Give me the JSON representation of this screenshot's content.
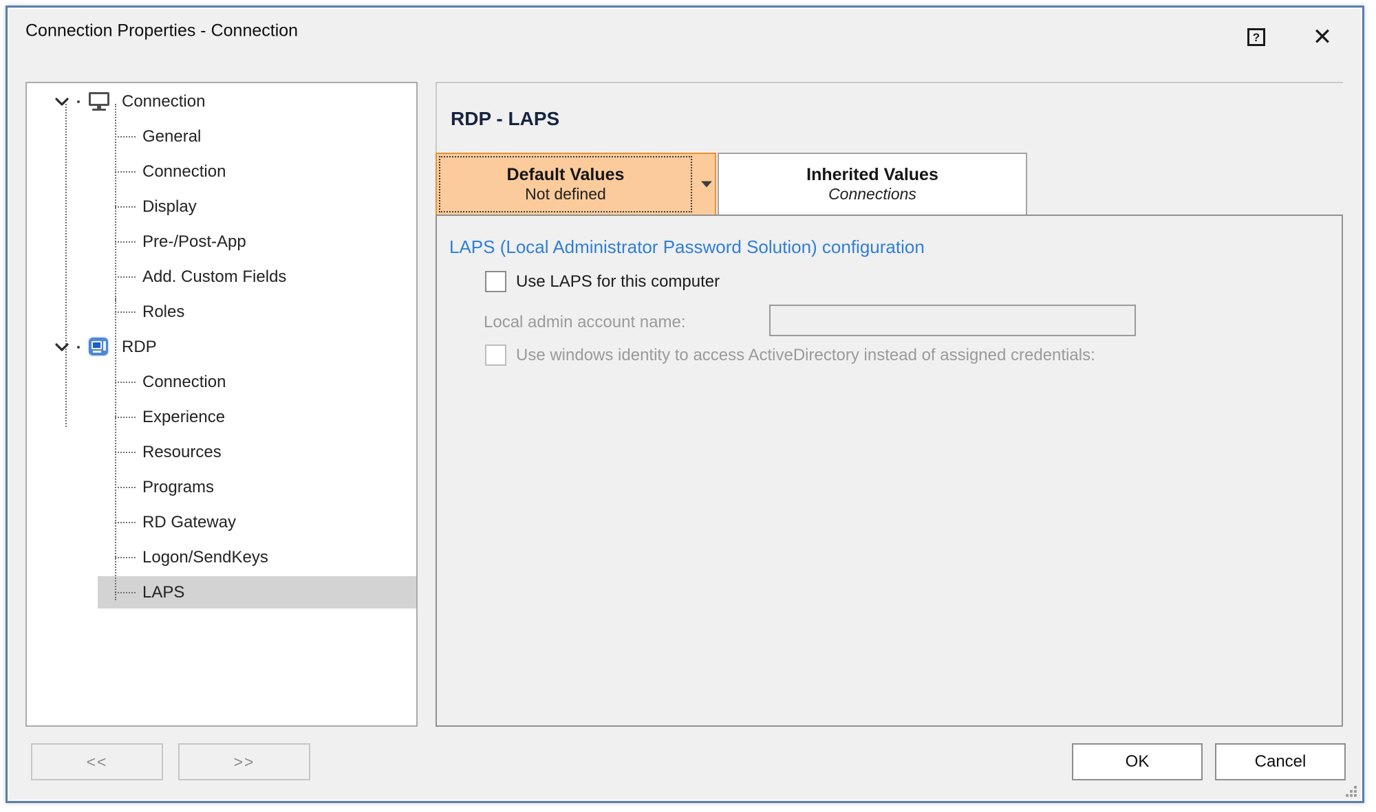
{
  "window": {
    "title": "Connection Properties - Connection",
    "help_icon": "help-icon",
    "help_glyph": "?",
    "close_icon": "close-icon",
    "close_glyph": "✕",
    "accent_border": "#5a7fad",
    "face_color": "#f0f0f0"
  },
  "tree": {
    "nodes": [
      {
        "label": "Connection",
        "level": 0,
        "icon": "monitor-icon",
        "expanded": true,
        "selected": false
      },
      {
        "label": "General",
        "level": 1,
        "icon": null,
        "expanded": null,
        "selected": false
      },
      {
        "label": "Connection",
        "level": 1,
        "icon": null,
        "expanded": null,
        "selected": false
      },
      {
        "label": "Display",
        "level": 1,
        "icon": null,
        "expanded": null,
        "selected": false
      },
      {
        "label": "Pre-/Post-App",
        "level": 1,
        "icon": null,
        "expanded": null,
        "selected": false
      },
      {
        "label": "Add. Custom Fields",
        "level": 1,
        "icon": null,
        "expanded": null,
        "selected": false
      },
      {
        "label": "Roles",
        "level": 1,
        "icon": null,
        "expanded": null,
        "selected": false
      },
      {
        "label": "RDP",
        "level": 0,
        "icon": "rdp-icon",
        "expanded": true,
        "selected": false
      },
      {
        "label": "Connection",
        "level": 1,
        "icon": null,
        "expanded": null,
        "selected": false
      },
      {
        "label": "Experience",
        "level": 1,
        "icon": null,
        "expanded": null,
        "selected": false
      },
      {
        "label": "Resources",
        "level": 1,
        "icon": null,
        "expanded": null,
        "selected": false
      },
      {
        "label": "Programs",
        "level": 1,
        "icon": null,
        "expanded": null,
        "selected": false
      },
      {
        "label": "RD Gateway",
        "level": 1,
        "icon": null,
        "expanded": null,
        "selected": false
      },
      {
        "label": "Logon/SendKeys",
        "level": 1,
        "icon": null,
        "expanded": null,
        "selected": false
      },
      {
        "label": "LAPS",
        "level": 1,
        "icon": null,
        "expanded": null,
        "selected": true
      }
    ],
    "selected_label": "LAPS",
    "selection_color": "#d3d3d3"
  },
  "navigation": {
    "prev_label": "<<",
    "next_label": ">>"
  },
  "pane": {
    "title": "RDP - LAPS",
    "tabs": [
      {
        "title": "Default Values",
        "subtitle": "Not defined",
        "active": true,
        "has_dropdown": true,
        "dropdown_icon": "chevron-down-icon",
        "background": "#fbcb9b",
        "border": "#e8922f"
      },
      {
        "title": "Inherited Values",
        "subtitle": "Connections",
        "active": false,
        "has_dropdown": false,
        "background": "#ffffff",
        "border": "#a4a4a4"
      }
    ]
  },
  "content": {
    "group_title": "LAPS (Local Administrator Password Solution) configuration",
    "group_title_color": "#2f7fd6",
    "use_laps": {
      "label": "Use LAPS for this computer",
      "checked": false,
      "enabled": true
    },
    "admin_account": {
      "label": "Local admin account name:",
      "value": "",
      "placeholder": "",
      "enabled": false
    },
    "win_identity": {
      "label": "Use windows identity to access ActiveDirectory instead of assigned credentials:",
      "checked": false,
      "enabled": false
    }
  },
  "actions": {
    "ok_label": "OK",
    "cancel_label": "Cancel"
  }
}
